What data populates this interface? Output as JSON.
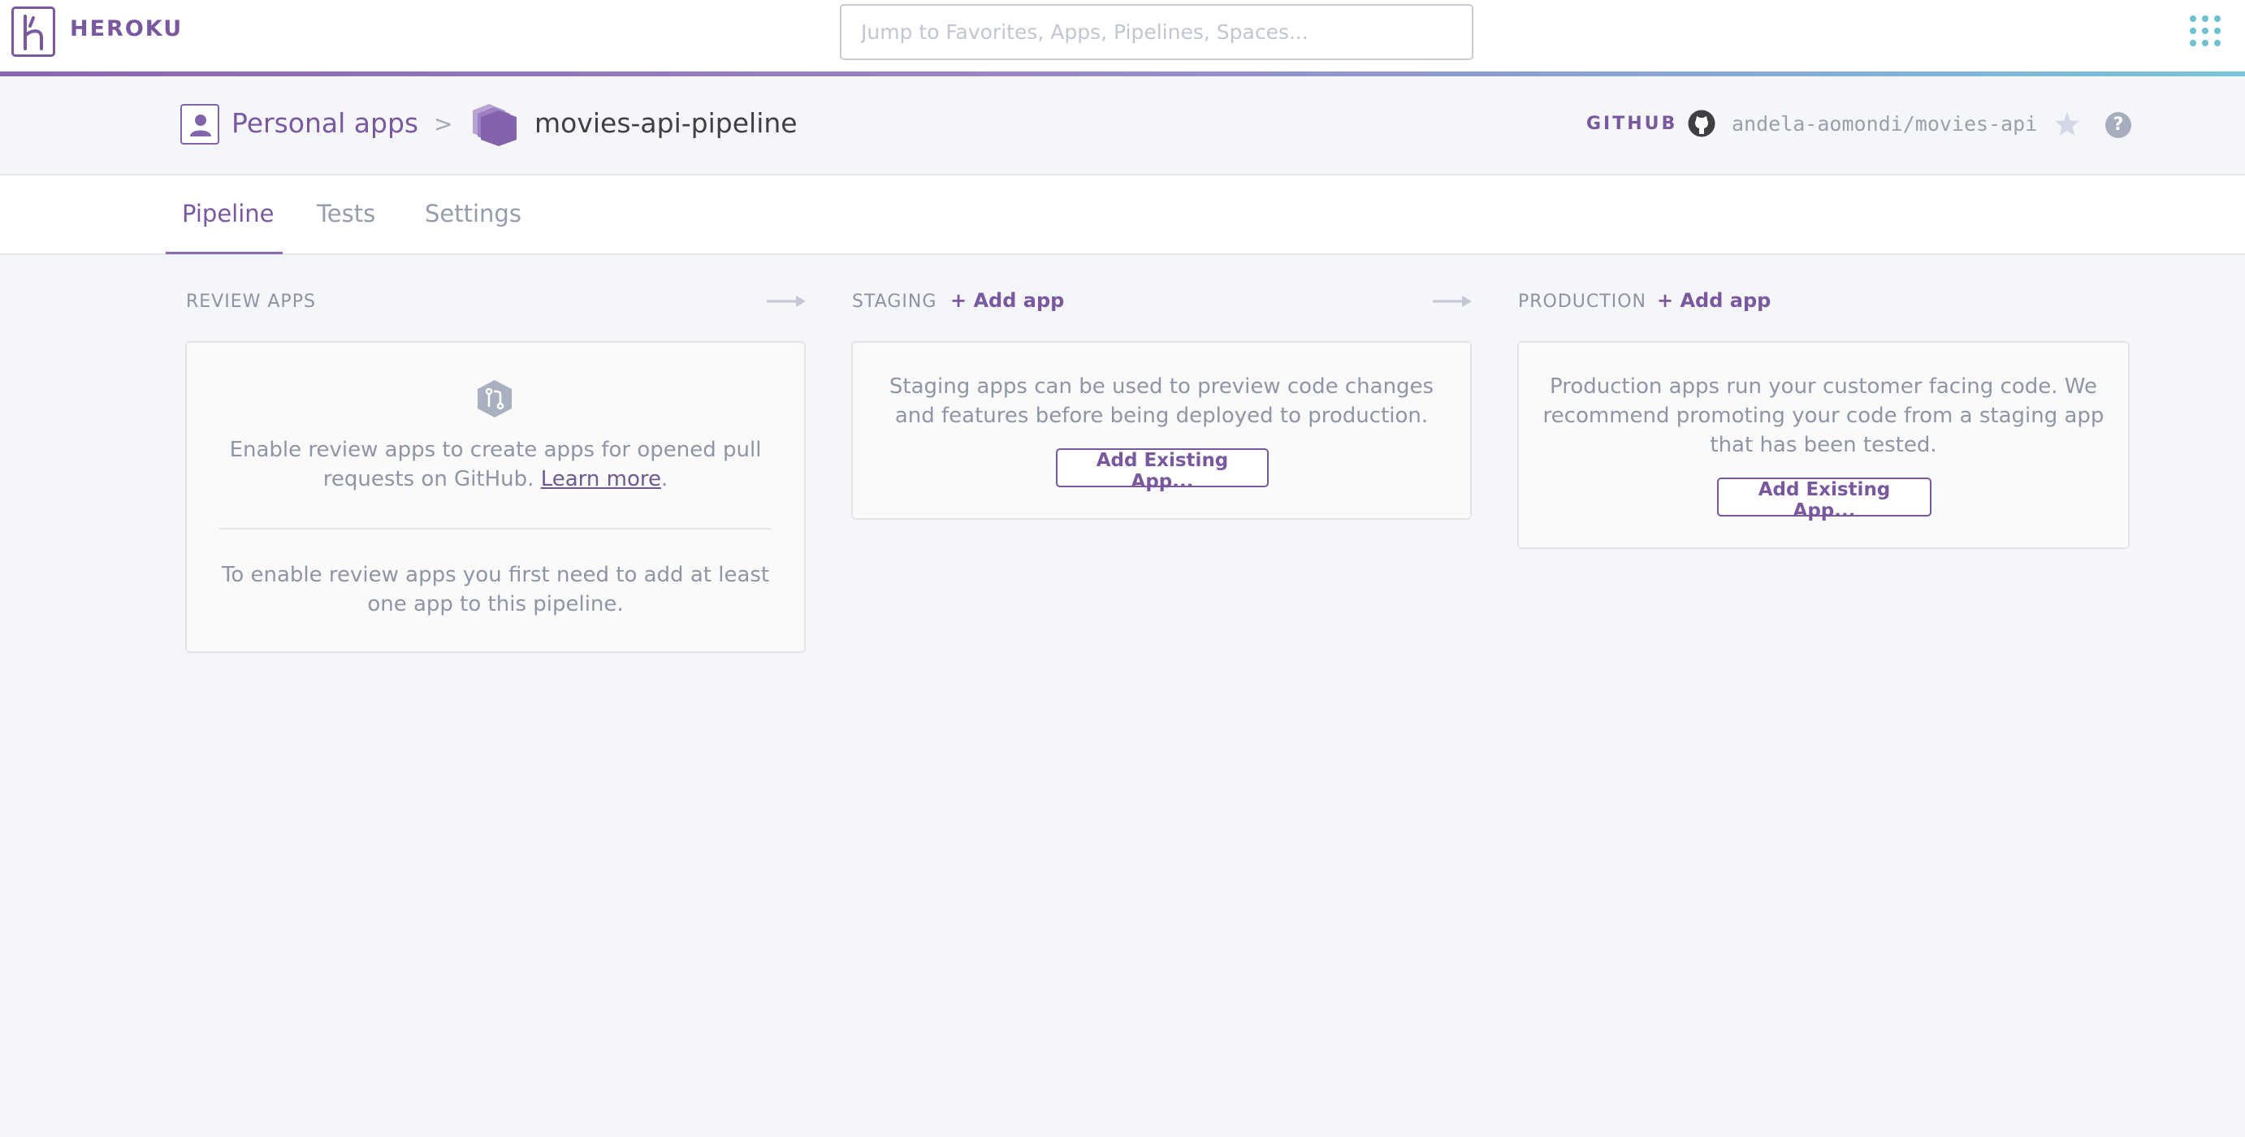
{
  "topbar": {
    "brand": "HEROKU",
    "search_placeholder": "Jump to Favorites, Apps, Pipelines, Spaces..."
  },
  "header": {
    "breadcrumb_personal": "Personal apps",
    "breadcrumb_separator": ">",
    "pipeline_name": "movies-api-pipeline",
    "github_label": "GITHUB",
    "github_repo": "andela-aomondi/movies-api"
  },
  "tabs": [
    {
      "label": "Pipeline",
      "active": true
    },
    {
      "label": "Tests",
      "active": false
    },
    {
      "label": "Settings",
      "active": false
    }
  ],
  "review_apps": {
    "label": "REVIEW APPS",
    "text_before_link": "Enable review apps to create apps for opened pull requests on GitHub. ",
    "learn_more": "Learn more",
    "text_after_link": ".",
    "note": "To enable review apps you first need to add at least one app to this pipeline."
  },
  "staging": {
    "label": "STAGING",
    "add_app": "+ Add app",
    "description": "Staging apps can be used to preview code changes and features before being deployed to production.",
    "button": "Add Existing App..."
  },
  "production": {
    "label": "PRODUCTION",
    "add_app": "+ Add app",
    "description": "Production apps run your customer facing code. We recommend promoting your code from a staging app that has been tested.",
    "button": "Add Existing App..."
  },
  "colors": {
    "brand_purple": "#79589f",
    "accent_teal": "#6cc2d2",
    "muted_text": "#8f95a6"
  }
}
